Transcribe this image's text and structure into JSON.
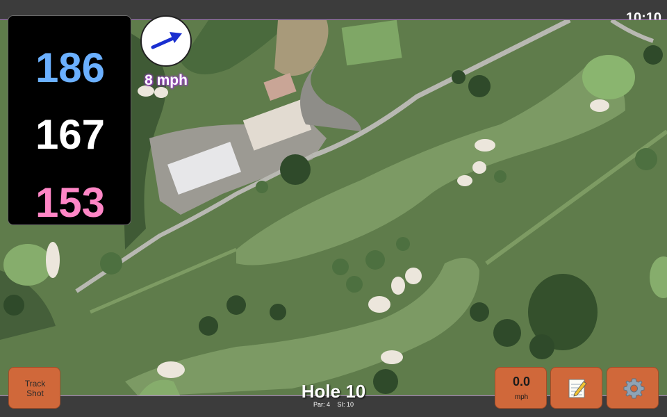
{
  "status": {
    "time": "10:10"
  },
  "distances": {
    "back": "186",
    "middle": "167",
    "front": "153"
  },
  "wind": {
    "speed": "8 mph",
    "direction_icon": "wind-arrow-icon"
  },
  "hole": {
    "title": "Hole 10",
    "par": "Par: 4",
    "stroke_index": "SI: 10"
  },
  "buttons": {
    "track_shot_line1": "Track",
    "track_shot_line2": "Shot",
    "speed_value": "0.0",
    "speed_unit": "mph",
    "notes_icon": "notepad-icon",
    "settings_icon": "gear-icon"
  },
  "colors": {
    "back_distance": "#6bb0ff",
    "middle_distance": "#ffffff",
    "front_distance": "#ff86c6",
    "button": "#d0683a",
    "wind_arrow": "#1a2fd0"
  }
}
